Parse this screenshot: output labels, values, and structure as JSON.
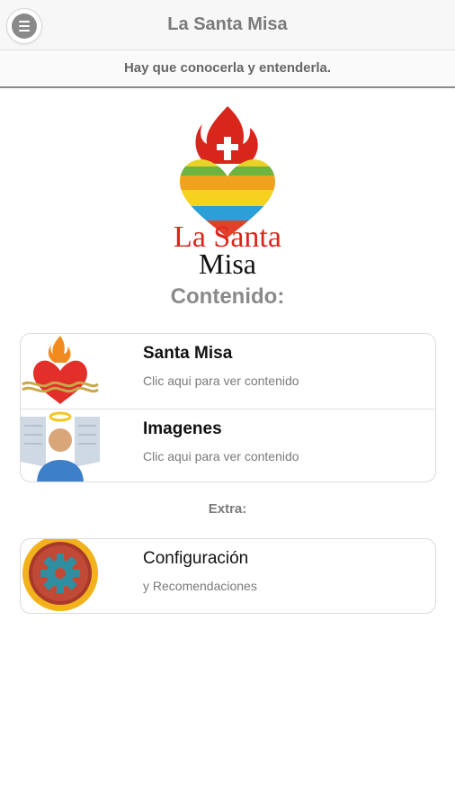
{
  "header": {
    "title": "La Santa Misa",
    "menu_icon": "hamburger-menu-icon"
  },
  "subheader": {
    "text": "Hay que conocerla y entenderla."
  },
  "logo": {
    "line1": "La Santa",
    "line2": "Misa",
    "icon": "sacred-heart-logo"
  },
  "sections": {
    "contenido": "Contenido:",
    "extra": "Extra:"
  },
  "menu_items": [
    {
      "label": "Santa Misa",
      "description": "Clic aqui para ver contenido",
      "icon": "sacred-heart-icon"
    },
    {
      "label": "Imagenes",
      "description": "Clic aqui para ver contenido",
      "icon": "angel-icon"
    }
  ],
  "extra_items": [
    {
      "label": "Configuración",
      "description": "y Recomendaciones",
      "icon": "gear-icon"
    }
  ],
  "colors": {
    "logo_red": "#d9261c",
    "accent_gray": "#8a8a8a",
    "gear_teal": "#2f8fa0",
    "gear_orange": "#e8b820"
  }
}
